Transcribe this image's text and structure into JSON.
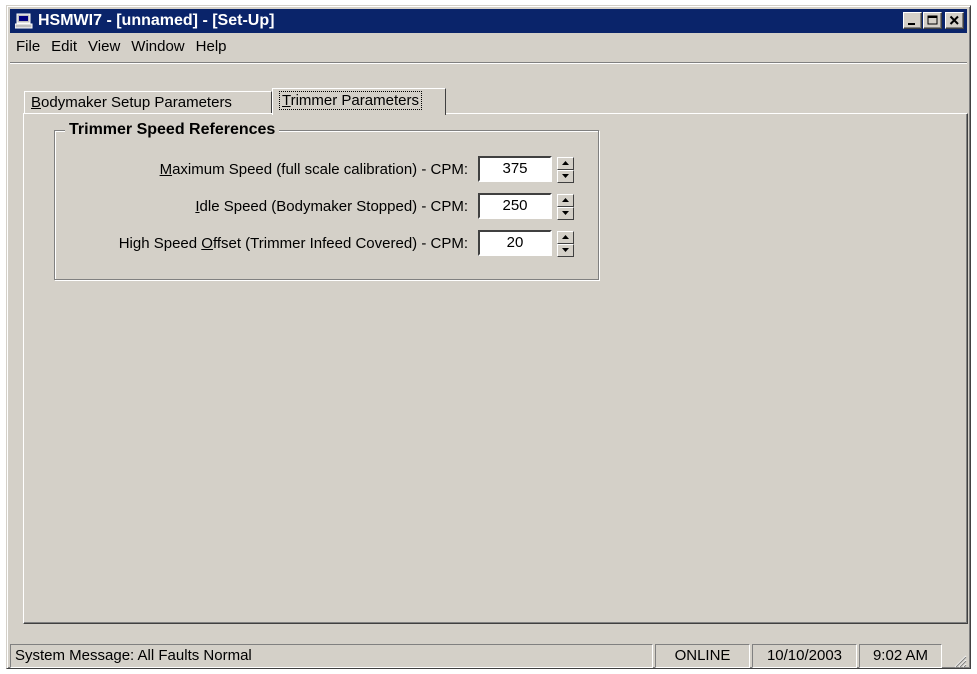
{
  "window": {
    "title": "HSMWI7 - [unnamed] - [Set-Up]",
    "icon": "computer-icon",
    "titlebar_color": "#0a246a",
    "face_color": "#d4d0c8"
  },
  "menu": {
    "file": "File",
    "edit": "Edit",
    "view": "View",
    "window": "Window",
    "help": "Help"
  },
  "tabs": {
    "bodymaker": {
      "accel": "B",
      "rest": "odymaker Setup Parameters"
    },
    "trimmer": {
      "accel": "T",
      "rest": "rimmer Parameters"
    }
  },
  "group": {
    "title": "Trimmer Speed References",
    "rows": [
      {
        "pre": "",
        "accel": "M",
        "post": "aximum Speed (full scale calibration) - CPM:",
        "value": "375"
      },
      {
        "pre": "",
        "accel": "I",
        "post": "dle Speed (Bodymaker Stopped) - CPM:",
        "value": "250"
      },
      {
        "pre": "High Speed ",
        "accel": "O",
        "post": "ffset (Trimmer Infeed Covered) - CPM:",
        "value": "20"
      }
    ]
  },
  "status": {
    "message": "System Message:  All Faults Normal",
    "connection": "ONLINE",
    "date": "10/10/2003",
    "time": "9:02 AM"
  }
}
